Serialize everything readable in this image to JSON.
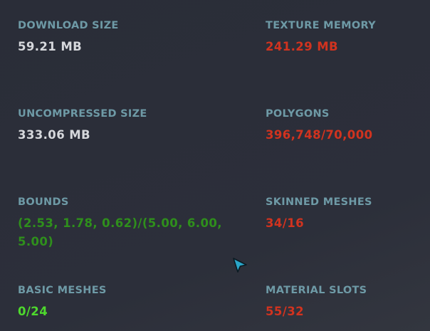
{
  "stats": {
    "download_size": {
      "label": "DOWNLOAD SIZE",
      "value": "59.21 MB"
    },
    "texture_memory": {
      "label": "TEXTURE MEMORY",
      "value": "241.29 MB"
    },
    "uncompressed_size": {
      "label": "UNCOMPRESSED SIZE",
      "value": "333.06 MB"
    },
    "polygons": {
      "label": "POLYGONS",
      "value": "396,748/70,000"
    },
    "bounds": {
      "label": "BOUNDS",
      "value": "(2.53, 1.78, 0.62)/(5.00, 6.00, 5.00)"
    },
    "skinned_meshes": {
      "label": "SKINNED MESHES",
      "value": "34/16"
    },
    "basic_meshes": {
      "label": "BASIC MESHES",
      "value": "0/24"
    },
    "material_slots": {
      "label": "MATERIAL SLOTS",
      "value": "55/32"
    }
  },
  "colors": {
    "label": "#6e9aa6",
    "ok_value": "#d6d8dc",
    "over_limit": "#d1331f",
    "within_limit": "#4ed92d",
    "bounds_value": "#2f8f1c",
    "cursor": "#2aa6c9"
  },
  "cursor_icon": "pointer-arrow-icon"
}
